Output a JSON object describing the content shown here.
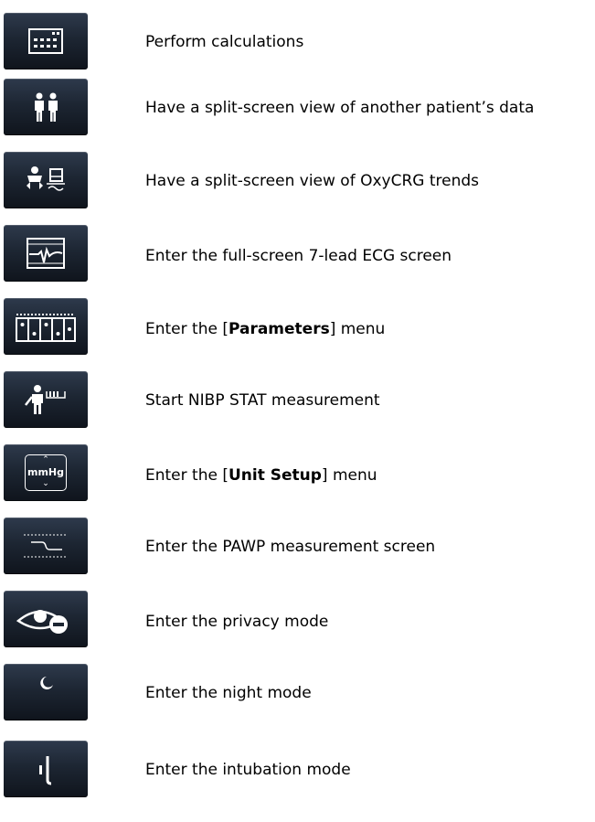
{
  "items": [
    {
      "icon": "calculator-icon",
      "text": "Perform calculations"
    },
    {
      "icon": "other-patient-icon",
      "text": "Have a split-screen view of another patient’s data"
    },
    {
      "icon": "oxycrg-icon",
      "text": "Have a split-screen view of OxyCRG trends"
    },
    {
      "icon": "ecg-7-lead-icon",
      "text": "Enter the full-screen 7-lead ECG screen"
    },
    {
      "icon": "parameters-icon",
      "pre": "Enter the [",
      "bold": "Parameters",
      "post": "] menu"
    },
    {
      "icon": "nibp-stat-icon",
      "text": "Start NIBP STAT measurement"
    },
    {
      "icon": "unit-setup-icon",
      "icon_text": "mmHg",
      "pre": "Enter the [",
      "bold": "Unit Setup",
      "post": "] menu"
    },
    {
      "icon": "pawp-icon",
      "text": "Enter the PAWP measurement screen"
    },
    {
      "icon": "privacy-mode-icon",
      "text": "Enter the privacy mode"
    },
    {
      "icon": "night-mode-icon",
      "text": "Enter the night mode"
    },
    {
      "icon": "intubation-icon",
      "text": "Enter the intubation mode"
    }
  ]
}
